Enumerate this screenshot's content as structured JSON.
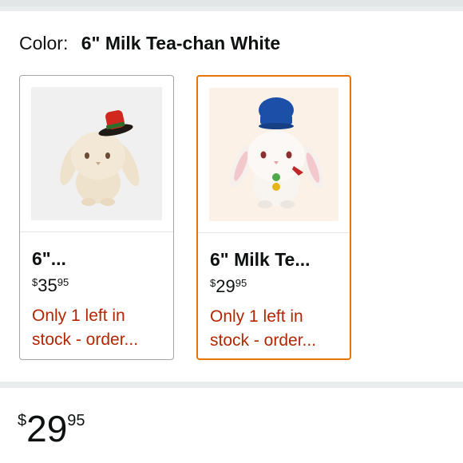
{
  "color_selector": {
    "label": "Color:",
    "selected_value": "6\" Milk Tea-chan White"
  },
  "swatches": [
    {
      "title": "6\"...",
      "price_symbol": "$",
      "price_whole": "35",
      "price_fraction": "95",
      "availability": "Only 1 left in stock - order...",
      "selected": false
    },
    {
      "title": "6\" Milk Te...",
      "price_symbol": "$",
      "price_whole": "29",
      "price_fraction": "95",
      "availability": "Only 1 left in stock - order...",
      "selected": true
    }
  ],
  "price": {
    "symbol": "$",
    "whole": "29",
    "fraction": "95"
  },
  "colors": {
    "selected_border": "#e77600",
    "availability_text": "#b12704"
  }
}
